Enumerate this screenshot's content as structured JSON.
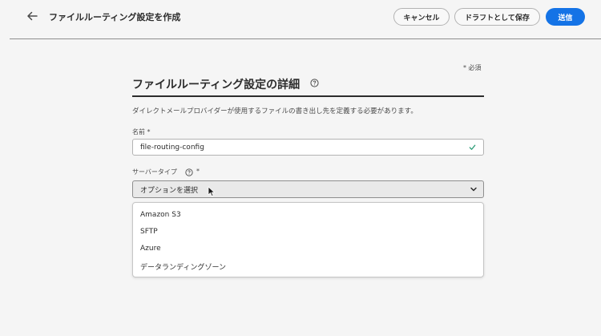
{
  "header": {
    "title": "ファイルルーティング設定を作成",
    "cancel_label": "キャンセル",
    "draft_label": "ドラフトとして保存",
    "submit_label": "送信",
    "back_icon": "arrow-left-icon"
  },
  "form": {
    "required_note": "* 必須",
    "section_title": "ファイルルーティング設定の詳細",
    "description": "ダイレクトメールプロバイダーが使用するファイルの書き出し先を定義する必要があります。",
    "name_label": "名前 *",
    "name_value": "file-routing-config",
    "type_label": "サーバータイプ",
    "type_asterisk": "*",
    "type_placeholder": "オプションを選択",
    "type_options": [
      "Amazon S3",
      "SFTP",
      "Azure",
      "データランディングゾーン"
    ]
  },
  "colors": {
    "accent": "#1473e6",
    "valid": "#2d9d78",
    "background": "#f5f5f5"
  }
}
